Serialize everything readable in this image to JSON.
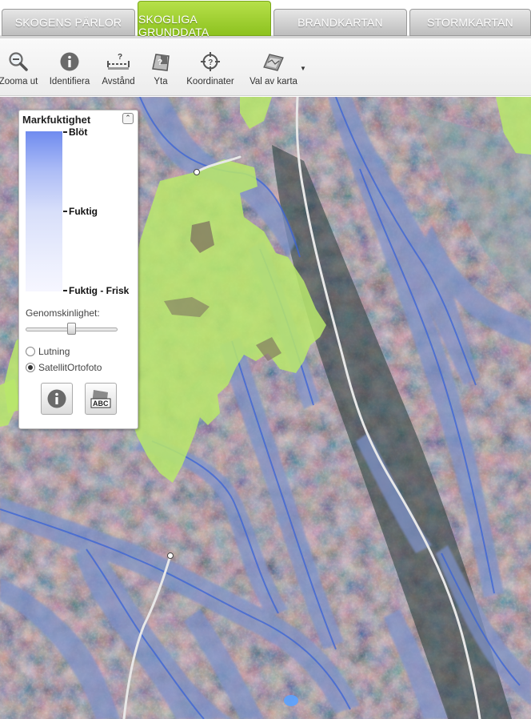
{
  "tabs": [
    {
      "label": "Skogens pärlor"
    },
    {
      "label": "Skogliga grunddata",
      "active": true
    },
    {
      "label": "Brandkartan"
    },
    {
      "label": "Stormkartan"
    }
  ],
  "toolbar": {
    "tools": [
      {
        "label": "Zooma ut",
        "icon": "zoom-out-icon"
      },
      {
        "label": "Identifiera",
        "icon": "info-icon"
      },
      {
        "label": "Avstånd",
        "icon": "measure-distance-icon"
      },
      {
        "label": "Yta",
        "icon": "measure-area-icon"
      },
      {
        "label": "Koordinater",
        "icon": "crosshair-icon"
      },
      {
        "label": "Val av karta",
        "icon": "map-layers-icon"
      }
    ]
  },
  "legend": {
    "title": "Markfuktighet",
    "classes": [
      "Blöt",
      "Fuktig",
      "Fuktig - Frisk"
    ],
    "opacity_label": "Genomskinlighet:",
    "opacity_value": 0.5,
    "base_options": [
      {
        "label": "Lutning",
        "selected": false
      },
      {
        "label": "SatellitOrtofoto",
        "selected": true
      }
    ],
    "label_button_text": "ABC"
  },
  "colors": {
    "tab_active": "#8dc21f",
    "tab_inactive": "#bdbdbd",
    "wet_overlay": "#6f8bef",
    "green_area": "#b8e86b"
  }
}
